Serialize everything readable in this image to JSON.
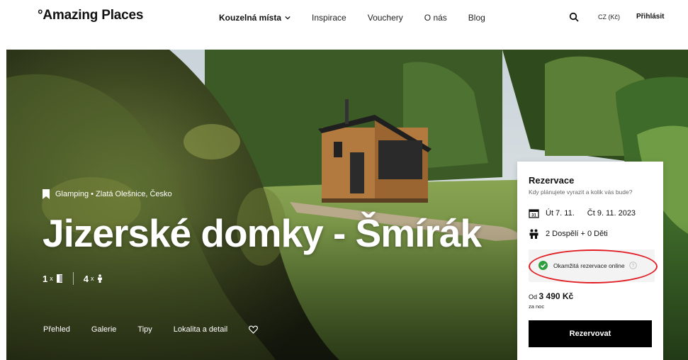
{
  "header": {
    "logo": "°Amazing Places",
    "nav": [
      {
        "label": "Kouzelná místa",
        "has_dropdown": true
      },
      {
        "label": "Inspirace"
      },
      {
        "label": "Vouchery"
      },
      {
        "label": "O nás"
      },
      {
        "label": "Blog"
      }
    ],
    "search_icon": "search-icon",
    "currency": "CZ (Kč)",
    "login": "Přihlásit"
  },
  "hero": {
    "tag_icon": "bookmark-icon",
    "tag": "Glamping • Zlatá Olešnice, Česko",
    "title": "Jizerské domky - Šmírák",
    "stats": [
      {
        "count": "1",
        "x": "x",
        "icon": "door-icon"
      },
      {
        "count": "4",
        "x": "x",
        "icon": "person-icon"
      }
    ],
    "subnav": [
      "Přehled",
      "Galerie",
      "Tipy",
      "Lokalita a detail"
    ],
    "favorite_icon": "heart-icon"
  },
  "reservation": {
    "title": "Rezervace",
    "subtitle": "Kdy plánujete vyrazit a kolik vás bude?",
    "calendar_icon": "calendar-icon",
    "calendar_day": "31",
    "date_from": "Út 7. 11.",
    "date_to": "Čt 9. 11. 2023",
    "guests_icon": "people-icon",
    "guests": "2 Dospělí + 0 Děti",
    "instant_icon": "check-circle-icon",
    "instant": "Okamžitá rezervace online",
    "help_icon": "help-icon",
    "help_glyph": "?",
    "price_prefix": "Od",
    "price": "3 490 Kč",
    "per_night": "za noc",
    "button": "Rezervovat",
    "highlight_color": "#e21d23"
  }
}
